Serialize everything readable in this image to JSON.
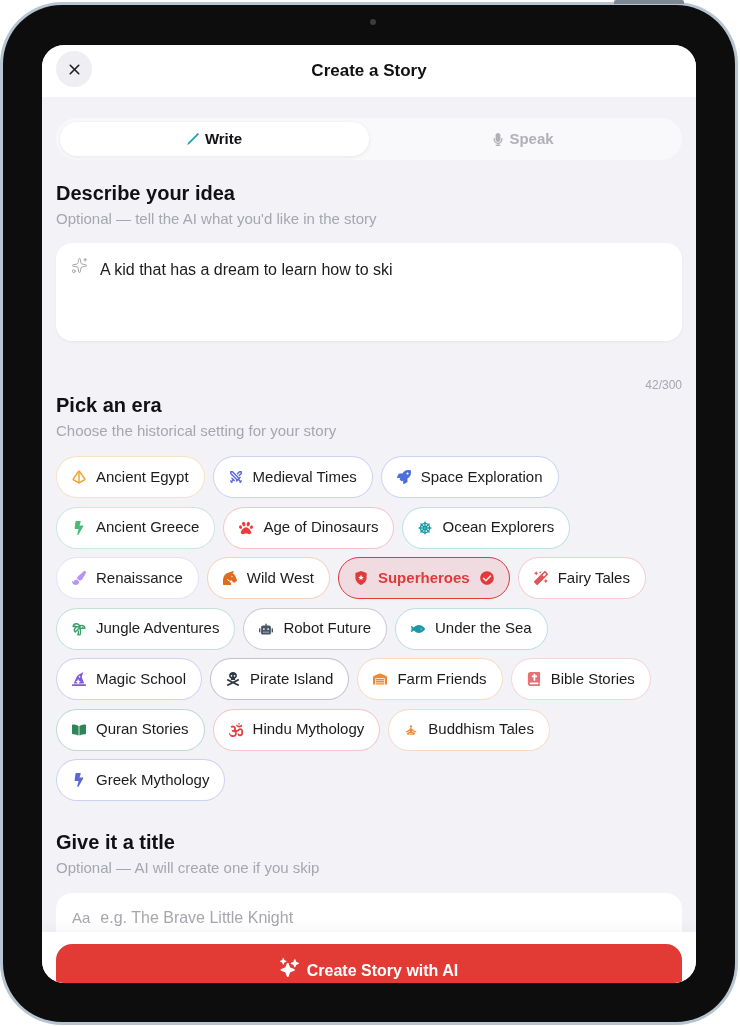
{
  "header": {
    "title": "Create a Story"
  },
  "mode_tabs": [
    {
      "label": "Write",
      "kind": "pencil",
      "selected": true
    },
    {
      "label": "Speak",
      "kind": "mic",
      "selected": false
    }
  ],
  "idea": {
    "heading": "Describe your idea",
    "subtitle": "Optional — tell the AI what you'd like in the story",
    "value": "A kid that has a dream to learn how to ski",
    "counter": "42/300"
  },
  "era": {
    "heading": "Pick an era",
    "subtitle": "Choose the historical setting for your story",
    "options": [
      {
        "label": "Ancient Egypt",
        "kind": "pyramid",
        "color": "#f0a030",
        "selected": false
      },
      {
        "label": "Medieval Times",
        "kind": "swords",
        "color": "#5a67d8",
        "selected": false
      },
      {
        "label": "Space Exploration",
        "kind": "rocket",
        "color": "#4c6fdc",
        "selected": false
      },
      {
        "label": "Ancient Greece",
        "kind": "bolt",
        "color": "#48bb78",
        "selected": false
      },
      {
        "label": "Age of Dinosaurs",
        "kind": "paw",
        "color": "#e53e3e",
        "selected": false
      },
      {
        "label": "Ocean Explorers",
        "kind": "wheel",
        "color": "#1b9aa6",
        "selected": false
      },
      {
        "label": "Renaissance",
        "kind": "brush",
        "color": "#b794f4",
        "selected": false
      },
      {
        "label": "Wild West",
        "kind": "horse",
        "color": "#dd6b20",
        "selected": false
      },
      {
        "label": "Superheroes",
        "kind": "shield",
        "color": "#e03a3a",
        "selected": true
      },
      {
        "label": "Fairy Tales",
        "kind": "wand",
        "color": "#e05555",
        "selected": false
      },
      {
        "label": "Jungle Adventures",
        "kind": "palm",
        "color": "#38a169",
        "selected": false
      },
      {
        "label": "Robot Future",
        "kind": "robot",
        "color": "#4a5568",
        "selected": false
      },
      {
        "label": "Under the Sea",
        "kind": "fish",
        "color": "#1b9aa6",
        "selected": false
      },
      {
        "label": "Magic School",
        "kind": "hat",
        "color": "#805ad5",
        "selected": false
      },
      {
        "label": "Pirate Island",
        "kind": "skull",
        "color": "#2d3748",
        "selected": false
      },
      {
        "label": "Farm Friends",
        "kind": "barn",
        "color": "#ed8936",
        "selected": false
      },
      {
        "label": "Bible Stories",
        "kind": "bible",
        "color": "#e57373",
        "selected": false
      },
      {
        "label": "Quran Stories",
        "kind": "book",
        "color": "#2f855a",
        "selected": false
      },
      {
        "label": "Hindu Mythology",
        "kind": "om",
        "color": "#e53e3e",
        "selected": false
      },
      {
        "label": "Buddhism Tales",
        "kind": "meditate",
        "color": "#ed8936",
        "selected": false
      },
      {
        "label": "Greek Mythology",
        "kind": "bolt",
        "color": "#5a67d8",
        "selected": false
      }
    ]
  },
  "title_section": {
    "heading": "Give it a title",
    "subtitle": "Optional — AI will create one if you skip",
    "prefix": "Aa",
    "placeholder": "e.g. The Brave Little Knight"
  },
  "create_button": {
    "label": "Create Story with AI"
  }
}
